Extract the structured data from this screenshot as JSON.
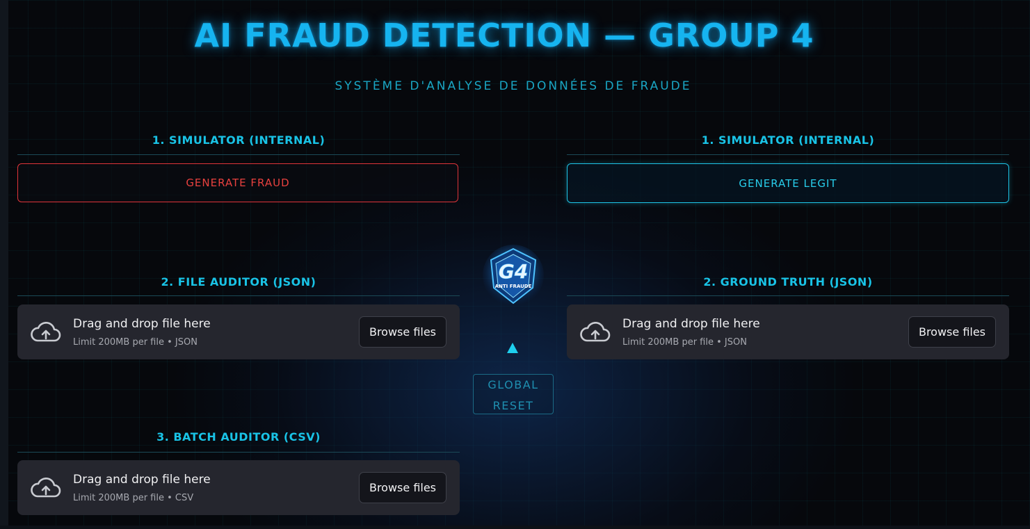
{
  "header": {
    "title": "AI FRAUD DETECTION — GROUP 4",
    "subtitle": "SYSTÈME D'ANALYSE DE DONNÉES DE FRAUDE"
  },
  "left": {
    "simulator_heading": "1. SIMULATOR (INTERNAL)",
    "generate_fraud_label": "GENERATE FRAUD",
    "file_auditor_heading": "2. FILE AUDITOR (JSON)",
    "file_auditor_drop": {
      "main": "Drag and drop file here",
      "sub": "Limit 200MB per file • JSON",
      "browse": "Browse files"
    },
    "batch_auditor_heading": "3. BATCH AUDITOR (CSV)",
    "batch_auditor_drop": {
      "main": "Drag and drop file here",
      "sub": "Limit 200MB per file • CSV",
      "browse": "Browse files"
    }
  },
  "right": {
    "simulator_heading": "1. SIMULATOR (INTERNAL)",
    "generate_legit_label": "GENERATE LEGIT",
    "ground_truth_heading": "2. GROUND TRUTH (JSON)",
    "ground_truth_drop": {
      "main": "Drag and drop file here",
      "sub": "Limit 200MB per file • JSON",
      "browse": "Browse files"
    }
  },
  "center": {
    "logo_text": "G4",
    "logo_subtext": "ANTI FRAUDE",
    "reset_line1": "GLOBAL",
    "reset_line2": "RESET"
  },
  "colors": {
    "title": "#16b4f0",
    "section_heading": "#19c3e6",
    "fraud_accent": "#e0343a",
    "legit_accent": "#1ec6e8",
    "dropzone_bg": "#25262e"
  },
  "icons": [
    "cloud-upload-icon",
    "arrow-up-icon",
    "g4-logo"
  ]
}
